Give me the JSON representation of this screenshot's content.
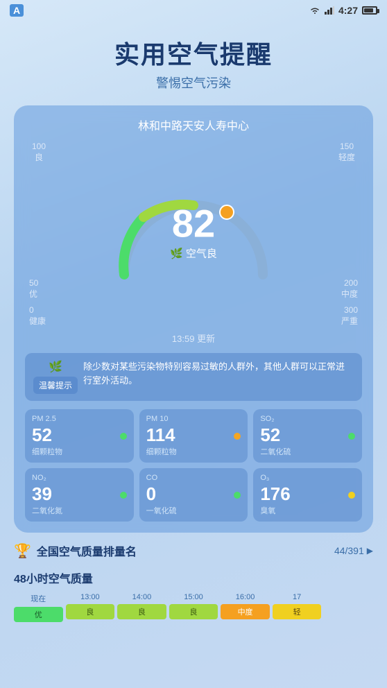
{
  "statusBar": {
    "appName": "A",
    "time": "4:27",
    "batteryLevel": 70
  },
  "header": {
    "title": "实用空气提醒",
    "subtitle": "警惕空气污染"
  },
  "card": {
    "location": "林和中路天安人寿中心",
    "aqi": "82",
    "aqiLabel": "空气良",
    "updateTime": "13:59 更新",
    "scaleLabels": [
      {
        "value": "0",
        "name": "健康"
      },
      {
        "value": "50",
        "name": "优"
      },
      {
        "value": "100",
        "name": "良"
      },
      {
        "value": "150",
        "name": "轻度"
      },
      {
        "value": "200",
        "name": "中度"
      },
      {
        "value": "300",
        "name": "严重"
      }
    ],
    "alertTag": "温馨提示",
    "alertText": "除少数对某些污染物特别容易过敏的人群外，其他人群可以正常进行室外活动。",
    "metrics": [
      {
        "id": "pm25",
        "label": "PM 2.5",
        "sublabel": "细颗粒物",
        "value": "52",
        "dotColor": "dot-green"
      },
      {
        "id": "pm10",
        "label": "PM 10",
        "sublabel": "细颗粒物",
        "value": "114",
        "dotColor": "dot-orange"
      },
      {
        "id": "so2",
        "label": "SO₂",
        "sublabel": "二氧化硫",
        "value": "52",
        "dotColor": "dot-green"
      },
      {
        "id": "no2",
        "label": "NO₂",
        "sublabel": "二氧化氮",
        "value": "39",
        "dotColor": "dot-green"
      },
      {
        "id": "co",
        "label": "CO",
        "sublabel": "一氧化硫",
        "value": "0",
        "dotColor": "dot-green"
      },
      {
        "id": "o3",
        "label": "O₃",
        "sublabel": "臭氧",
        "value": "176",
        "dotColor": "dot-yellow"
      }
    ]
  },
  "ranking": {
    "title": "全国空气质量排量名",
    "value": "44/391",
    "chevron": "▶"
  },
  "hourly": {
    "title": "48小时空气质量",
    "columns": [
      {
        "label": "现在",
        "badge": "优",
        "badgeClass": "badge-green"
      },
      {
        "label": "13:00",
        "badge": "良",
        "badgeClass": "badge-lime"
      },
      {
        "label": "14:00",
        "badge": "良",
        "badgeClass": "badge-lime"
      },
      {
        "label": "15:00",
        "badge": "良",
        "badgeClass": "badge-lime"
      },
      {
        "label": "16:00",
        "badge": "中度",
        "badgeClass": "badge-orange"
      },
      {
        "label": "17",
        "badge": "轻",
        "badgeClass": "badge-light"
      }
    ]
  }
}
